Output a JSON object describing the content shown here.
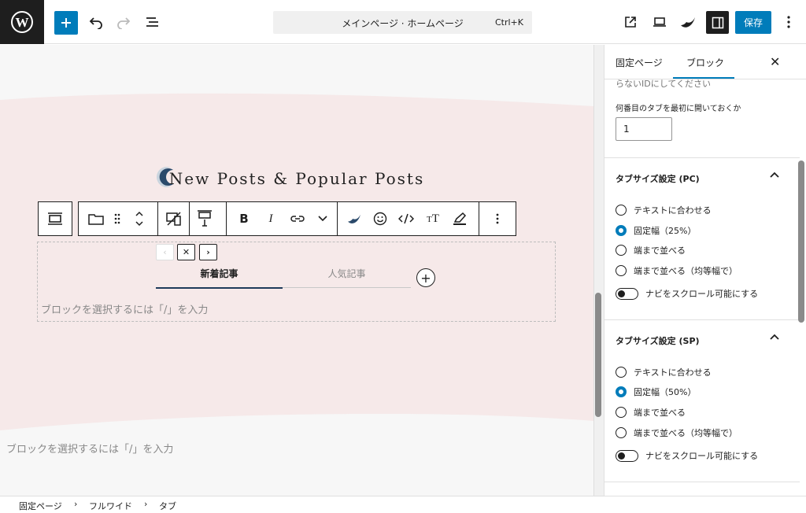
{
  "topbar": {
    "command_title": "メインページ · ホームページ",
    "command_shortcut": "Ctrl+K",
    "save_label": "保存"
  },
  "canvas": {
    "section_title": "New Posts & Popular Posts",
    "tabs": [
      "新着記事",
      "人気記事"
    ],
    "placeholder_inner": "ブロックを選択するには「/」を入力",
    "placeholder_outer": "ブロックを選択するには「/」を入力",
    "background_color": "#f6e9e9"
  },
  "sidebar": {
    "tab_page": "固定ページ",
    "tab_block": "ブロック",
    "cut_text": "らないIDにしてください",
    "open_tab_label": "何番目のタブを最初に開いておくか",
    "open_tab_value": "1",
    "panel_pc": {
      "title": "タブサイズ設定 (PC)",
      "options": [
        "テキストに合わせる",
        "固定幅（25%）",
        "端まで並べる",
        "端まで並べる（均等幅で）"
      ],
      "selected": 1,
      "toggle_label": "ナビをスクロール可能にする"
    },
    "panel_sp": {
      "title": "タブサイズ設定 (SP)",
      "options": [
        "テキストに合わせる",
        "固定幅（50%）",
        "端まで並べる",
        "端まで並べる（均等幅で）"
      ],
      "selected": 1,
      "toggle_label": "ナビをスクロール可能にする"
    },
    "accent_color": "#007cba"
  },
  "breadcrumb": [
    "固定ページ",
    "フルワイド",
    "タブ"
  ]
}
